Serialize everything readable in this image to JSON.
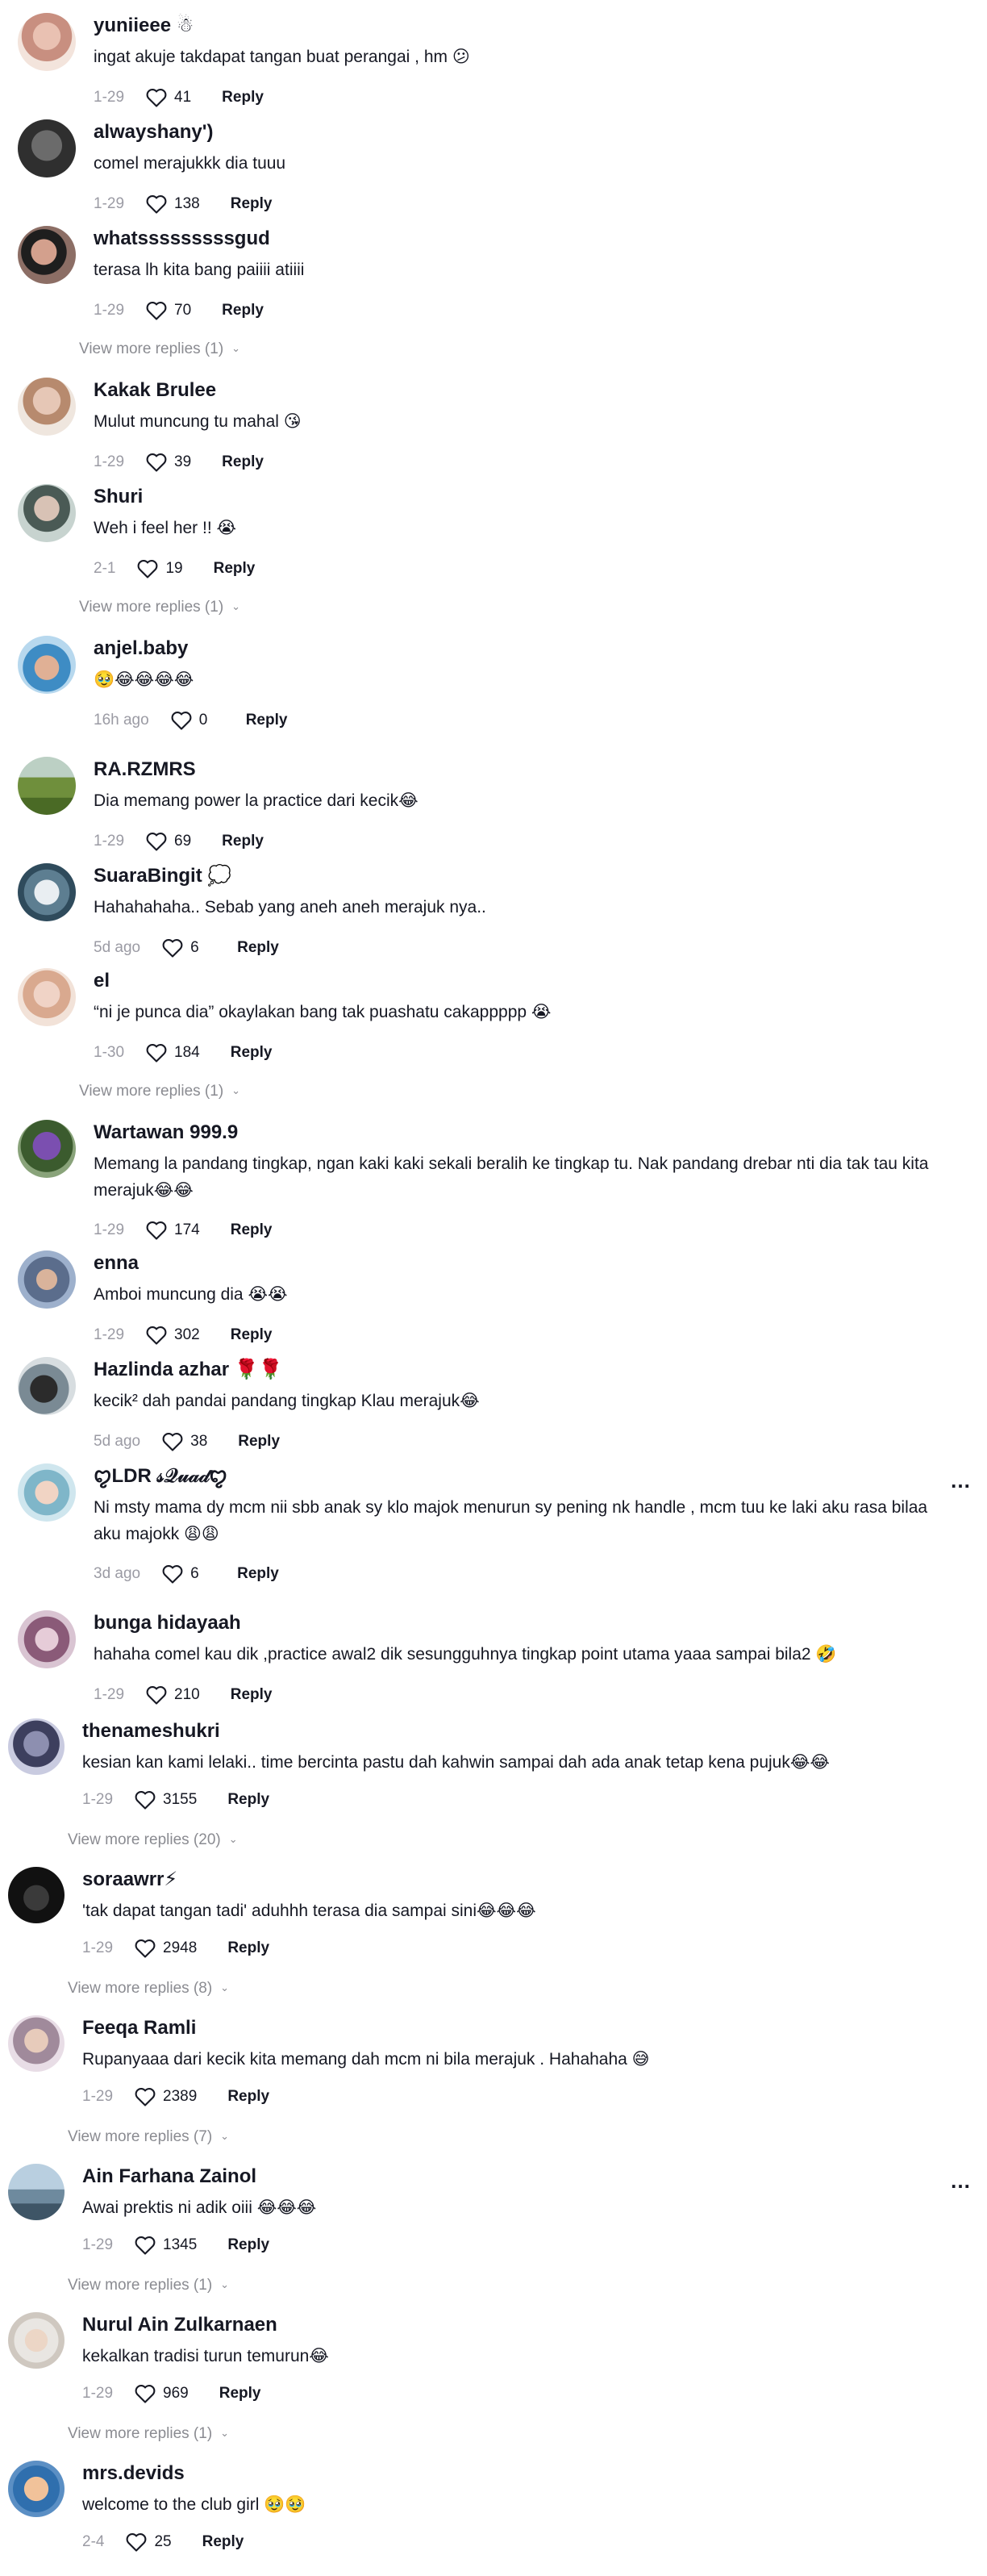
{
  "ui": {
    "reply_label": "Reply",
    "more_icon": "…",
    "chevron_icon": "⌄"
  },
  "comments": [
    {
      "author": "yuniieee ☃",
      "text": "ingat akuje takdapat tangan buat perangai , hm 😕",
      "date": "1-29",
      "likes": "41"
    },
    {
      "author": "alwayshany')",
      "text": "comel merajukkk dia tuuu",
      "date": "1-29",
      "likes": "138"
    },
    {
      "author": "whatsssssssssgud",
      "text": "terasa lh kita bang paiiii atiiii",
      "date": "1-29",
      "likes": "70",
      "more": "View more replies (1)"
    },
    {
      "author": "Kakak Brulee",
      "text": "Mulut muncung tu mahal 😘",
      "date": "1-29",
      "likes": "39"
    },
    {
      "author": "Shuri",
      "text": "Weh i feel her !! 😭",
      "date": "2-1",
      "likes": "19",
      "more": "View more replies (1)"
    },
    {
      "author": "anjel.baby",
      "text": "🥹😂😂😂😂",
      "date": "16h ago",
      "likes": "0"
    },
    {
      "author": "RA.RZMRS",
      "text": "Dia memang power la practice dari kecik😂",
      "date": "1-29",
      "likes": "69"
    },
    {
      "author": "SuaraBingit 💭",
      "text": "Hahahahaha.. Sebab yang aneh aneh merajuk nya..",
      "date": "5d ago",
      "likes": "6"
    },
    {
      "author": "el",
      "text": "“ni je punca dia” okaylakan bang tak puashatu cakappppp 😭",
      "date": "1-30",
      "likes": "184",
      "more": "View more replies (1)"
    },
    {
      "author": "Wartawan 999.9",
      "text": "Memang la pandang tingkap, ngan kaki kaki sekali beralih ke tingkap tu. Nak pandang drebar nti dia tak tau kita merajuk😂😂",
      "date": "1-29",
      "likes": "174"
    },
    {
      "author": "enna",
      "text": "Amboi muncung dia 😭😭",
      "date": "1-29",
      "likes": "302"
    },
    {
      "author": "Hazlinda azhar 🌹🌹",
      "text": "kecik² dah pandai pandang tingkap Klau merajuk😂",
      "date": "5d ago",
      "likes": "38"
    },
    {
      "author": "ꨄLDR 𝓈𝒬𝓊𝒶𝒹ꨄ",
      "text": "Ni msty mama dy mcm nii sbb anak sy klo majok menurun sy pening nk handle , mcm tuu ke laki aku rasa bilaa aku majokk 😩😩",
      "date": "3d ago",
      "likes": "6"
    },
    {
      "author": "bunga hidayaah",
      "text": "hahaha comel kau dik ,practice awal2 dik sesungguhnya tingkap point utama yaaa sampai bila2 🤣",
      "date": "1-29",
      "likes": "210"
    },
    {
      "author": "thenameshukri",
      "text": "kesian kan kami lelaki.. time bercinta pastu dah kahwin sampai dah ada anak tetap kena pujuk😂😂",
      "date": "1-29",
      "likes": "3155",
      "more": "View more replies (20)"
    },
    {
      "author": "soraawrr⚡",
      "text": "'tak dapat tangan tadi' aduhhh terasa dia sampai sini😂😂😂",
      "date": "1-29",
      "likes": "2948",
      "more": "View more replies (8)"
    },
    {
      "author": "Feeqa Ramli",
      "text": "Rupanyaaa dari kecik kita memang dah mcm ni bila merajuk . Hahahaha 😅",
      "date": "1-29",
      "likes": "2389",
      "more": "View more replies (7)"
    },
    {
      "author": "Ain Farhana Zainol",
      "text": "Awai prektis ni adik oiii 😂😂😂",
      "date": "1-29",
      "likes": "1345",
      "more": "View more replies (1)"
    },
    {
      "author": "Nurul Ain Zulkarnaen",
      "text": "kekalkan tradisi turun temurun😂",
      "date": "1-29",
      "likes": "969",
      "more": "View more replies (1)"
    },
    {
      "author": "mrs.devids",
      "text": "welcome to the club girl 🥹🥹",
      "date": "2-4",
      "likes": "25"
    }
  ]
}
